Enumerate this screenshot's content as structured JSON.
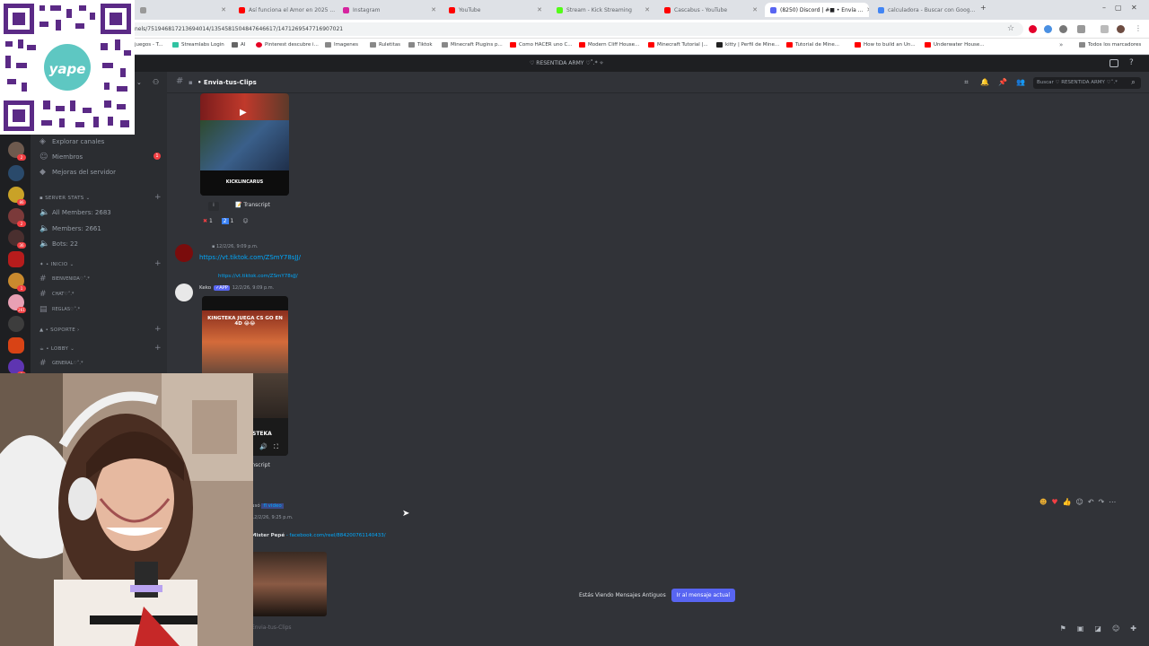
{
  "browser": {
    "tabs": [
      {
        "label": "",
        "color": "#888888"
      },
      {
        "label": "Así funciona el Amor en 2025 ...",
        "color": "#ff0000"
      },
      {
        "label": "Instagram",
        "color": "#d6249f"
      },
      {
        "label": "YouTube",
        "color": "#ff0000"
      },
      {
        "label": "Stream - Kick Streaming",
        "color": "#53fc18"
      },
      {
        "label": "Cascabus - YouTube",
        "color": "#ff0000"
      },
      {
        "label": "(8250) Discord | #■ • Envía ...",
        "color": "#5865f2"
      },
      {
        "label": "calculadora - Buscar con Goog...",
        "color": "#4285f4"
      }
    ],
    "url": "nels/751946817213694014/1354581504847646617/1471269547716907021",
    "bookmarks": [
      {
        "label": "juegos - T...",
        "color": "#888888"
      },
      {
        "label": "Streamlabs Login",
        "color": "#31c3a2"
      },
      {
        "label": "AI",
        "color": "#666666"
      },
      {
        "label": "Pinterest descubre i...",
        "color": "#e60023"
      },
      {
        "label": "Imagenes",
        "color": "#888888"
      },
      {
        "label": "Ruletitas",
        "color": "#888888"
      },
      {
        "label": "Tiktok",
        "color": "#888888"
      },
      {
        "label": "Minecraft Plugins p...",
        "color": "#888888"
      },
      {
        "label": "Como HACER uno C...",
        "color": "#ff0000"
      },
      {
        "label": "Modern Cliff House...",
        "color": "#ff0000"
      },
      {
        "label": "Minecraft Tutorial |...",
        "color": "#ff0000"
      },
      {
        "label": "kitty | Perfil de Mine...",
        "color": "#222222"
      },
      {
        "label": "Tutorial de Mine...",
        "color": "#ff0000"
      },
      {
        "label": "How to build an Un...",
        "color": "#ff0000"
      },
      {
        "label": "Underwater House...",
        "color": "#ff0000"
      },
      {
        "label": "Todos los marcadores",
        "color": "#888888"
      }
    ]
  },
  "discord": {
    "server_title": "♡ RESENTIDA ARMY ♡˚.* ✧",
    "channel_name": "Envia-tus-Clips",
    "search_placeholder": "Buscar ♡ RESENTIDA ARMY ♡˚.*",
    "guild_badges": [
      "2",
      "86",
      "2",
      "36",
      "1",
      "261",
      "2"
    ],
    "sidebar": {
      "items": [
        {
          "label": "Explorar canales"
        },
        {
          "label": "Miembros",
          "badge": "1"
        },
        {
          "label": "Mejoras del servidor"
        }
      ],
      "categories": [
        {
          "label": "SERVER STATS",
          "channels": [
            "All Members: 2683",
            "Members: 2661",
            "Bots: 22"
          ]
        },
        {
          "label": "INICIO",
          "channels": [
            "BIENVENIDA♡˚.*",
            "CHAT♡˚.*",
            "REGLAS♡˚.*"
          ]
        },
        {
          "label": "SOPORTE",
          "channels": []
        },
        {
          "label": "LOBBY",
          "channels": [
            "GENERAL♡˚.*"
          ]
        }
      ]
    },
    "messages": {
      "m1": {
        "thumb_label": "KICKLINCARUS",
        "transcript": "Transcript",
        "reactions": [
          "1",
          "1"
        ]
      },
      "m2": {
        "time": "12/2/26, 9:09 p.m.",
        "link": "https://vt.tiktok.com/ZSmY78sJJ/"
      },
      "m3": {
        "reply_link": "https://vt.tiktok.com/ZSmY78sJJ/",
        "author": "Keko",
        "app_badge": "APP",
        "time": "12/2/26, 9:09 p.m.",
        "video_caption": "KINGTEKA JUEGA CS GO EN 4D 😂😂",
        "video_bottom": "STEKA",
        "transcript": "Transcript"
      },
      "m4": {
        "header_prefix": "usó",
        "header_link": "fl video",
        "time": "12/2/26, 9:25 p.m.",
        "author": "Mister Pepé",
        "link": "facebook.com/reel/884200761140433/"
      }
    },
    "jump_text": "Estás Viendo Mensajes Antiguos",
    "jump_button": "Ir al mensaje actual",
    "footer_channel": "Envia-tus-Clips"
  },
  "overlay": {
    "qr_label": "yape"
  }
}
